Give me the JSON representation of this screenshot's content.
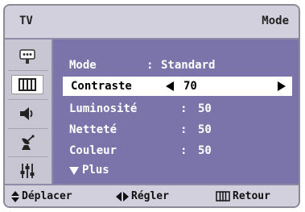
{
  "header": {
    "source_label": "TV",
    "title": "Mode"
  },
  "sidebar": {
    "items": [
      {
        "icon": "input-icon"
      },
      {
        "icon": "picture-icon",
        "active": true
      },
      {
        "icon": "sound-icon"
      },
      {
        "icon": "antenna-icon"
      },
      {
        "icon": "setup-icon"
      }
    ]
  },
  "menu": {
    "rows": [
      {
        "label": "Mode",
        "separator": ":",
        "value": "Standard"
      },
      {
        "label": "Contraste",
        "value": "70",
        "selected": true
      },
      {
        "label": "Luminosité",
        "separator": ":",
        "value": "50"
      },
      {
        "label": "Netteté",
        "separator": ":",
        "value": "50"
      },
      {
        "label": "Couleur",
        "separator": ":",
        "value": "50"
      }
    ],
    "more_label": "Plus"
  },
  "footer": {
    "move_label": "Déplacer",
    "adjust_label": "Régler",
    "return_label": "Retour"
  },
  "colors": {
    "panel": "#7a74ab",
    "frame": "#c9c6d4",
    "header": "#d3d0de",
    "selected_row": "#ffffff"
  }
}
